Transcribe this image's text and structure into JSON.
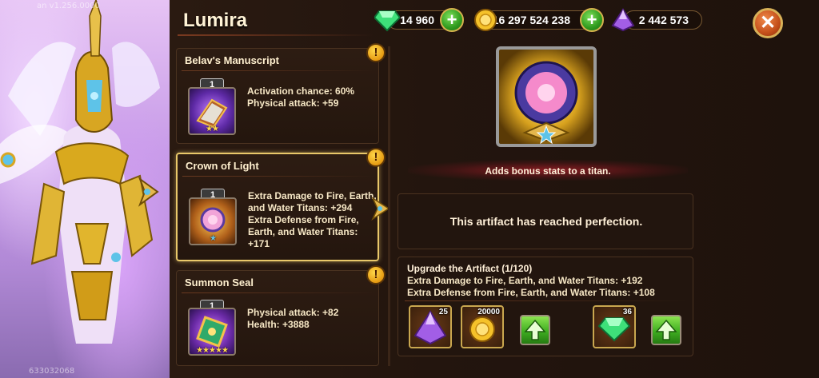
{
  "hero": {
    "name": "Lumira",
    "version_text": "an v1.256.0000",
    "id_text": "633032068"
  },
  "currencies": {
    "emeralds": "14 960",
    "gold": "16 297 524 238",
    "titan_potion": "2 442 573"
  },
  "artifacts": [
    {
      "name": "Belav's Manuscript",
      "level": "1",
      "stars": 2,
      "stats": [
        "Activation chance: 60%",
        "Physical attack: +59"
      ],
      "alert": "!"
    },
    {
      "name": "Crown of Light",
      "level": "1",
      "stars": 1,
      "selected": true,
      "stats": [
        "Extra Damage to Fire, Earth,",
        "and Water Titans: +294",
        "Extra Defense from Fire,",
        "Earth, and Water Titans:",
        "+171"
      ],
      "alert": "!"
    },
    {
      "name": "Summon Seal",
      "level": "1",
      "stars": 5,
      "stats": [
        "Physical attack: +82",
        "Health: +3888"
      ],
      "alert": "!"
    }
  ],
  "selected_artifact": {
    "description": "Adds bonus stats to a titan.",
    "status": "This artifact has reached perfection."
  },
  "upgrade": {
    "title": "Upgrade the Artifact (1/120)",
    "lines": [
      "Extra Damage to Fire, Earth, and Water Titans: +192",
      "Extra Defense from Fire, Earth, and Water Titans: +108"
    ],
    "resources": [
      {
        "icon": "purple-crystal-icon",
        "count": "25"
      },
      {
        "icon": "gold-coin-icon",
        "count": "20000"
      },
      {
        "icon": "emerald-icon",
        "count": "36"
      }
    ]
  },
  "colors": {
    "panel_bg": "#23150e",
    "gold_border": "#e9c86a",
    "green_button": "#3fae21",
    "alert_yellow": "#ffd84a"
  }
}
